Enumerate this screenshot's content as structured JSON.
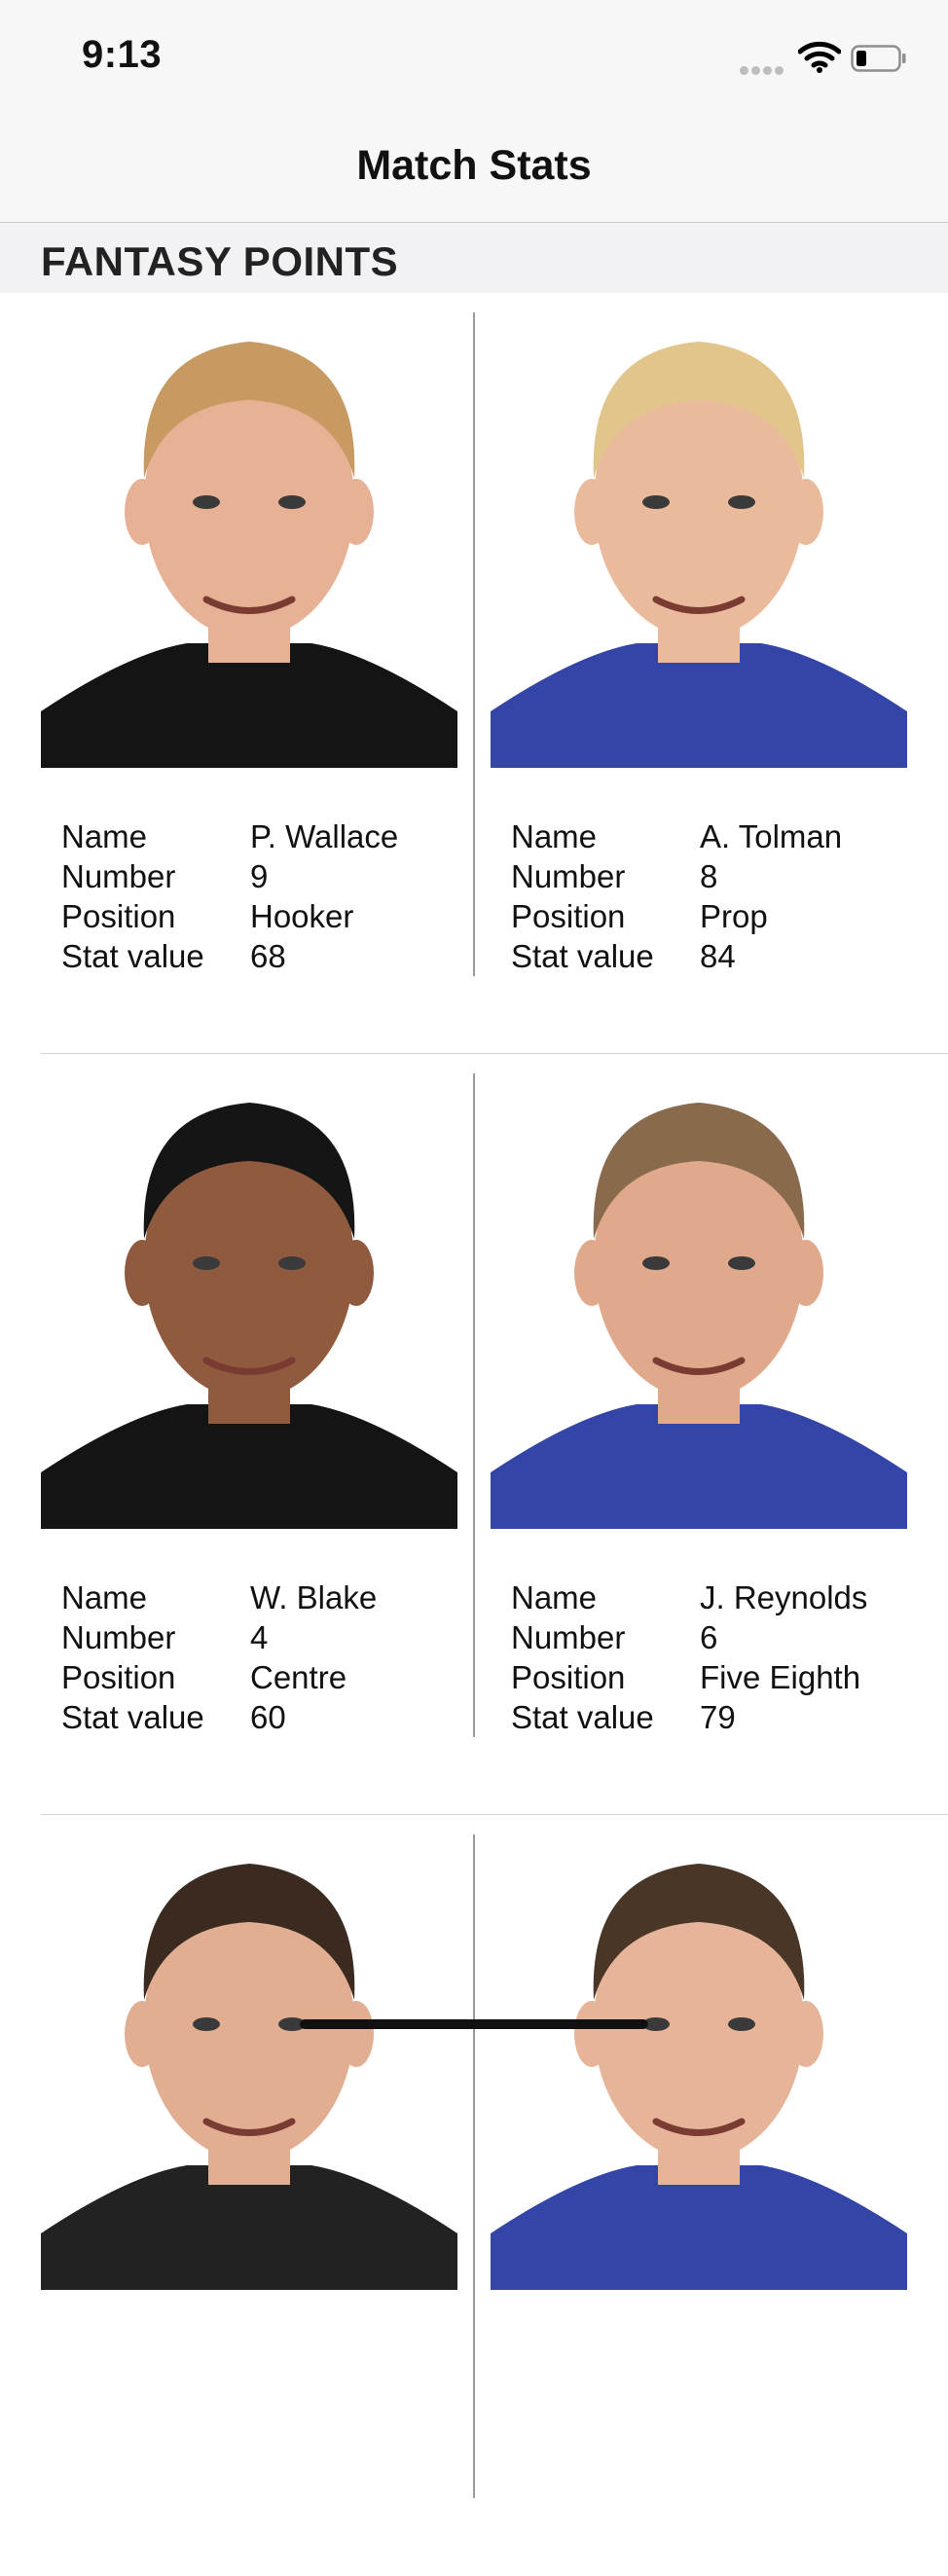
{
  "status_bar": {
    "time": "9:13"
  },
  "nav": {
    "title": "Match Stats"
  },
  "section": {
    "title": "FANTASY POINTS"
  },
  "stat_labels": {
    "name": "Name",
    "number": "Number",
    "position": "Position",
    "stat_value": "Stat value"
  },
  "players": [
    {
      "name": "P. Wallace",
      "number": "9",
      "position": "Hooker",
      "stat_value": "68",
      "hair": "#c79a62",
      "skin": "#e7b196",
      "jersey": "#141414"
    },
    {
      "name": "A. Tolman",
      "number": "8",
      "position": "Prop",
      "stat_value": "84",
      "hair": "#e2c58a",
      "skin": "#e9bb9c",
      "jersey": "#3345a6"
    },
    {
      "name": "W. Blake",
      "number": "4",
      "position": "Centre",
      "stat_value": "60",
      "hair": "#151515",
      "skin": "#8f5a3e",
      "jersey": "#141414"
    },
    {
      "name": "J. Reynolds",
      "number": "6",
      "position": "Five Eighth",
      "stat_value": "79",
      "hair": "#8a6a4c",
      "skin": "#e0a98b",
      "jersey": "#3345a6"
    },
    {
      "name": "",
      "number": "",
      "position": "",
      "stat_value": "",
      "hair": "#3a2a20",
      "skin": "#e1ae92",
      "jersey": "#222222"
    },
    {
      "name": "",
      "number": "",
      "position": "",
      "stat_value": "",
      "hair": "#4a3626",
      "skin": "#e6b498",
      "jersey": "#3345a6"
    }
  ]
}
